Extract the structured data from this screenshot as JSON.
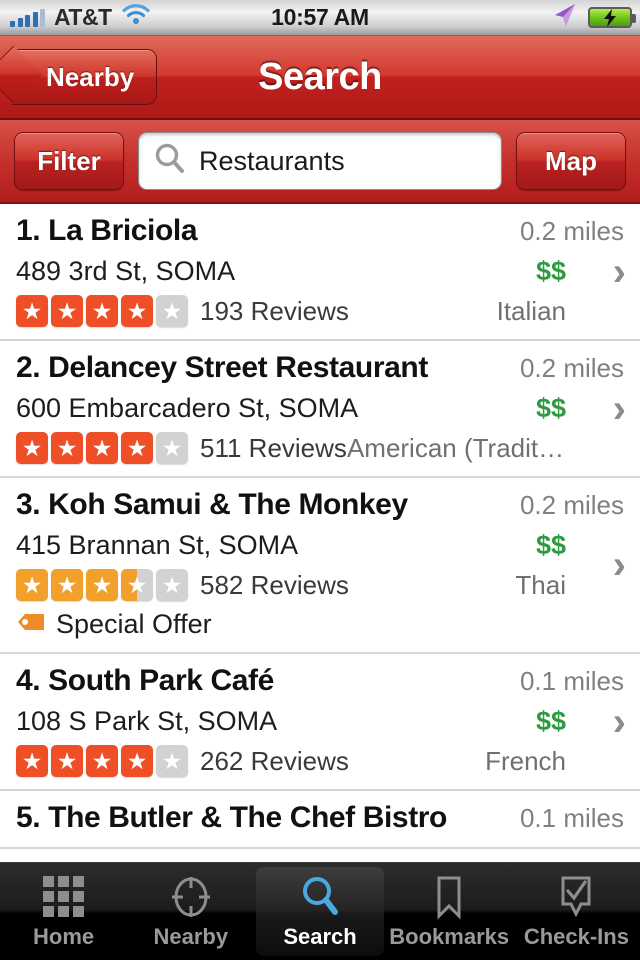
{
  "status_bar": {
    "carrier": "AT&T",
    "time": "10:57 AM",
    "signal_icon": "signal-bars-icon",
    "wifi_icon": "wifi-icon",
    "location_icon": "location-arrow-icon",
    "battery_icon": "battery-charging-icon",
    "signal_bars": 4,
    "signal_bars_total": 5
  },
  "nav": {
    "back_label": "Nearby",
    "title": "Search"
  },
  "search": {
    "filter_label": "Filter",
    "map_label": "Map",
    "value": "Restaurants",
    "placeholder": "Restaurants",
    "icon": "search-magnifier-icon"
  },
  "colors": {
    "nav_red": "#c5302b",
    "star_red": "#ef4f27",
    "star_amber": "#f2a02c",
    "price_green": "#2e9b41",
    "offer_orange": "#ef8b27",
    "active_tab_blue": "#4aa8e0"
  },
  "results": [
    {
      "rank": "1.",
      "name": "1. La Briciola",
      "distance": "0.2 miles",
      "address": "489 3rd St, SOMA",
      "price": "$$",
      "rating": 4,
      "star_color": "red",
      "reviews": "193 Reviews",
      "category": "Italian",
      "offer": null
    },
    {
      "rank": "2.",
      "name": "2. Delancey Street Restaurant",
      "distance": "0.2 miles",
      "address": "600 Embarcadero St, SOMA",
      "price": "$$",
      "rating": 4,
      "star_color": "red",
      "reviews": "511 Reviews",
      "category": "American (Tradition…",
      "offer": null
    },
    {
      "rank": "3.",
      "name": "3. Koh Samui & The Monkey",
      "distance": "0.2 miles",
      "address": "415 Brannan St, SOMA",
      "price": "$$",
      "rating": 3.5,
      "star_color": "amber",
      "reviews": "582 Reviews",
      "category": "Thai",
      "offer": "Special Offer"
    },
    {
      "rank": "4.",
      "name": "4. South Park Café",
      "distance": "0.1 miles",
      "address": "108 S Park St, SOMA",
      "price": "$$",
      "rating": 4,
      "star_color": "red",
      "reviews": "262 Reviews",
      "category": "French",
      "offer": null
    },
    {
      "rank": "5.",
      "name": "5. The Butler & The Chef Bistro",
      "distance": "0.1 miles",
      "address": "",
      "price": "",
      "rating": 0,
      "star_color": "red",
      "reviews": "",
      "category": "",
      "offer": null
    }
  ],
  "tabs": [
    {
      "label": "Home",
      "icon": "grid-icon",
      "active": false
    },
    {
      "label": "Nearby",
      "icon": "crosshair-icon",
      "active": false
    },
    {
      "label": "Search",
      "icon": "search-magnifier-icon",
      "active": true
    },
    {
      "label": "Bookmarks",
      "icon": "bookmark-icon",
      "active": false
    },
    {
      "label": "Check-Ins",
      "icon": "checkmark-badge-icon",
      "active": false
    }
  ]
}
